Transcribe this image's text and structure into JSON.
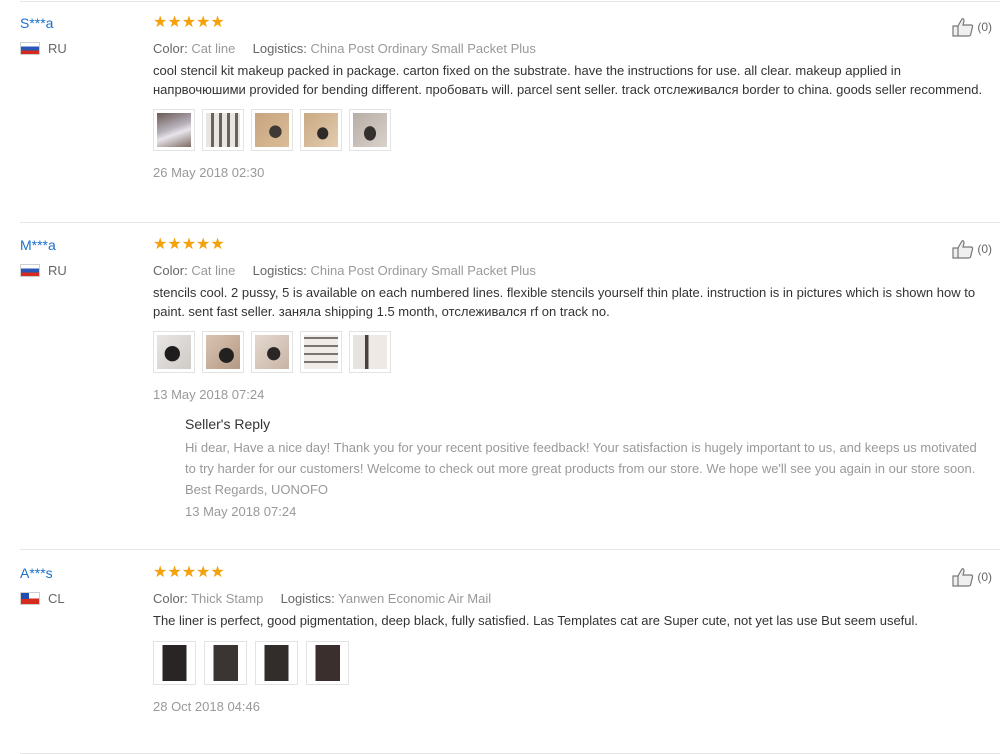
{
  "labels": {
    "color": "Color:",
    "logistics": "Logistics:"
  },
  "reviews": [
    {
      "user": "S***a",
      "country": "RU",
      "stars": "★★★★★",
      "color": "Cat line",
      "logistics": "China Post Ordinary Small Packet Plus",
      "text": "cool stencil kit makeup packed in package. carton fixed on the substrate. have the instructions for use. all clear. makeup applied in напрвочюшими provided for bending different. пробовать will. parcel sent seller. track отслеживался border to china. goods seller recommend.",
      "date": "26 May 2018 02:30",
      "helpful": "(0)"
    },
    {
      "user": "M***a",
      "country": "RU",
      "stars": "★★★★★",
      "color": "Cat line",
      "logistics": "China Post Ordinary Small Packet Plus",
      "text": "stencils cool. 2 pussy, 5 is available on each numbered lines. flexible stencils yourself thin plate. instruction is in pictures which is shown how to paint. sent fast seller. заняла shipping 1.5 month, отслеживался rf on track no.",
      "date": "13 May 2018 07:24",
      "helpful": "(0)",
      "reply": {
        "title": "Seller's Reply",
        "text": "Hi dear, Have a nice day! Thank you for your recent positive feedback! Your satisfaction is hugely important to us, and keeps us motivated to try harder for our customers! Welcome to check out more great products from our store. We hope we'll see you again in our store soon. Best Regards, UONOFO",
        "date": "13 May 2018 07:24"
      }
    },
    {
      "user": "A***s",
      "country": "CL",
      "stars": "★★★★★",
      "color": "Thick Stamp",
      "logistics": "Yanwen Economic Air Mail",
      "text": "The liner is perfect, good pigmentation, deep black, fully satisfied. Las Templates cat are Super cute, not yet las use But seem useful.",
      "date": "28 Oct 2018 04:46",
      "helpful": "(0)"
    }
  ],
  "colors": {
    "username": "#1a6fc8",
    "stars": "#f4a10b",
    "muted": "#999999"
  }
}
